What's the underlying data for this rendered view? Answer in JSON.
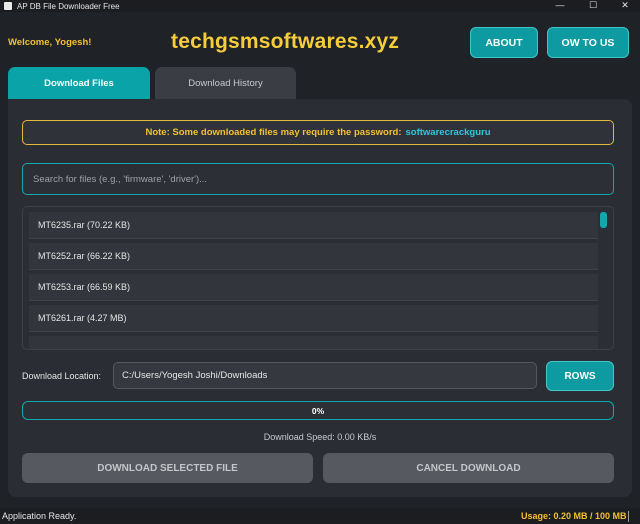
{
  "window": {
    "title": "AP DB File Downloader Free",
    "controls": {
      "minimize": "—",
      "maximize": "☐",
      "close": "✕"
    }
  },
  "header": {
    "welcome": "Welcome, Yogesh!",
    "site": "techgsmsoftwares.xyz",
    "about_label": "ABOUT",
    "howto_label": "OW TO US"
  },
  "tabs": [
    {
      "label": "Download Files",
      "active": true
    },
    {
      "label": "Download History",
      "active": false
    }
  ],
  "note": {
    "text": "Note: Some downloaded files may require the password:",
    "password": "softwarecrackguru"
  },
  "search": {
    "value": "",
    "placeholder": "Search for files (e.g., 'firmware', 'driver')..."
  },
  "files": [
    {
      "name": "MT6235.rar (70.22 KB)"
    },
    {
      "name": "MT6252.rar (66.22 KB)"
    },
    {
      "name": "MT6253.rar (66.59 KB)"
    },
    {
      "name": "MT6261.rar (4.27 MB)"
    },
    {
      "name": ""
    }
  ],
  "location": {
    "label": "Download Location:",
    "value": "C:/Users/Yogesh Joshi/Downloads",
    "browse_label": "ROWS"
  },
  "progress": {
    "value": 0,
    "label": "0%"
  },
  "speed": "Download Speed: 0.00 KB/s",
  "actions": {
    "download_label": "DOWNLOAD SELECTED FILE",
    "cancel_label": "CANCEL DOWNLOAD"
  },
  "status": {
    "text": "Application Ready.",
    "usage": "Usage: 0.20 MB / 100 MB"
  },
  "colors": {
    "accent": "#0d9aa0",
    "gold": "#f2c230",
    "link": "#2fc7e0",
    "background": "#1f2227"
  }
}
